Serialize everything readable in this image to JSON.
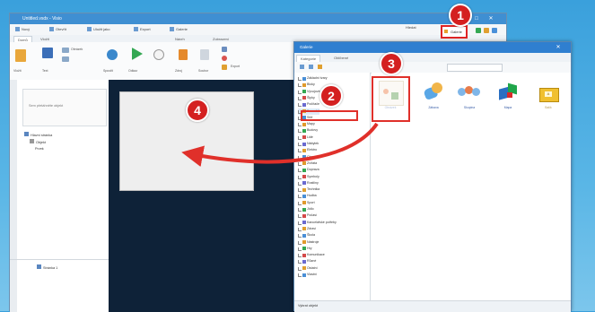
{
  "main_window": {
    "title": "Untitled.vsdx - Visio",
    "toolbar_items": [
      "Nový",
      "Otevřít",
      "Uložit jako",
      "Export",
      "Galerie"
    ],
    "tabs": [
      "Domů",
      "Vložit",
      "Návrh",
      "Zobrazení"
    ],
    "ribbon_labels": [
      "Vložit",
      "Text",
      "Obrázek",
      "Spustit",
      "Odkaz",
      "Zdroj",
      "Soubor",
      "Export"
    ],
    "left_pane": {
      "prop_hint": "Sem přetáhněte objekt",
      "tree": [
        "Hlavní stránka",
        "Objekt",
        "Prvek",
        "Stránka 1"
      ]
    },
    "search_text": "Hledat",
    "gallery_button": "Galerie"
  },
  "gallery_dialog": {
    "title": "Galerie",
    "tabs": [
      "Kategorie",
      "Oblíbené"
    ],
    "list": [
      "Základní tvary",
      "Bloky",
      "Vývojové diagramy",
      "Šipky",
      "Počítače",
      "Kancelář",
      "Sítě",
      "Mapy",
      "Budovy",
      "Lidé",
      "Nábytek",
      "Elektro",
      "Chemie",
      "Zvířata",
      "Doprava",
      "Symboly",
      "Rostliny",
      "Technika",
      "Hudba",
      "Sport",
      "Jídlo",
      "Počasí",
      "Kancelářské potřeby",
      "Zdraví",
      "Škola",
      "Nástroje",
      "Hry",
      "Komunikace",
      "Různé",
      "Ostatní",
      "Vlastní"
    ],
    "selected_index": 5,
    "tiles": [
      {
        "label": "Obrázek",
        "icon": "image-thumbnail-icon"
      },
      {
        "label": "Zábava",
        "icon": "people-icon"
      },
      {
        "label": "Skupina",
        "icon": "group-icon"
      },
      {
        "label": "Mapa",
        "icon": "cube-icon"
      },
      {
        "label": "Balík",
        "icon": "package-icon"
      }
    ],
    "bottom_status": "Vybrat objekt"
  },
  "badges": [
    "1",
    "2",
    "3",
    "4"
  ],
  "colors": {
    "accent": "#3f8fd2",
    "highlight": "#e0302a",
    "canvas": "#0e2238",
    "background": "#3aa0dc"
  }
}
